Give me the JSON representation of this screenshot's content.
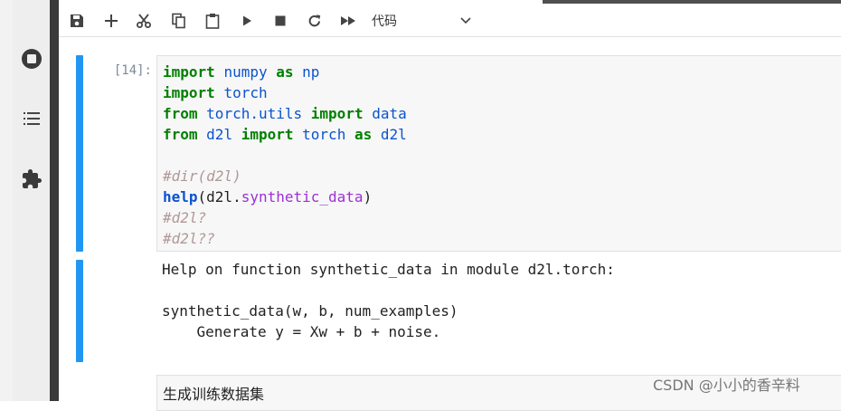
{
  "toolbar": {
    "buttons": [
      "save-icon",
      "add-cell-icon",
      "cut-icon",
      "copy-icon",
      "paste-icon",
      "run-icon",
      "stop-icon",
      "restart-icon",
      "fast-forward-icon"
    ],
    "cell_type": "代码"
  },
  "sidebar": {
    "icons": [
      "stop-circle-icon",
      "list-icon",
      "puzzle-icon"
    ]
  },
  "cell": {
    "prompt": "[14]:",
    "code_lines": [
      "import numpy as np",
      "import torch",
      "from torch.utils import data",
      "from d2l import torch as d2l",
      "",
      "#dir(d2l)",
      "help(d2l.synthetic_data)",
      "#d2l?",
      "#d2l??"
    ],
    "output_lines": [
      "Help on function synthetic_data in module d2l.torch:",
      "",
      "synthetic_data(w, b, num_examples)",
      "    Generate y = Xw + b + noise."
    ]
  },
  "markdown_cell": {
    "text": "生成训练数据集"
  },
  "watermark": "CSDN @小小的香辛料",
  "colors": {
    "accent": "#2196f3",
    "keyword": "#008000",
    "module": "#0b53ce",
    "comment": "#b09898"
  }
}
